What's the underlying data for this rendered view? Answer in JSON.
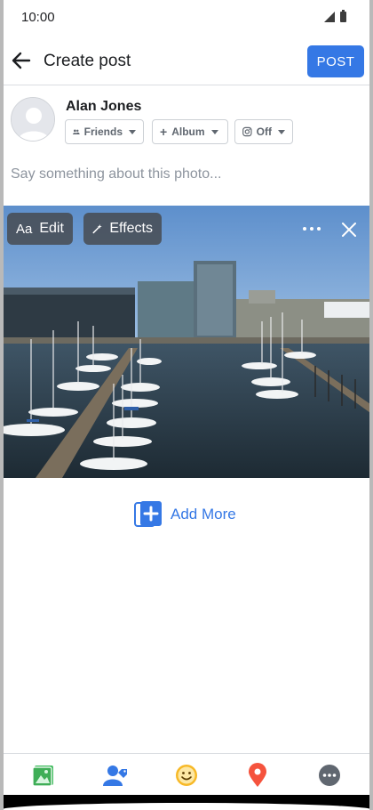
{
  "status_bar": {
    "time": "10:00"
  },
  "app_bar": {
    "title": "Create post",
    "post_label": "POST"
  },
  "author": {
    "name": "Alan Jones",
    "audience_label": "Friends",
    "album_label": "Album",
    "instagram_label": "Off"
  },
  "composer": {
    "placeholder": "Say something about this photo..."
  },
  "photo": {
    "edit_label": "Edit",
    "edit_icon_text": "Aa",
    "effects_label": "Effects"
  },
  "add_more": {
    "label": "Add More"
  },
  "bottom_toolbar": {
    "items": [
      "photo-video-icon",
      "tag-people-icon",
      "feeling-icon",
      "check-in-icon",
      "more-options-icon"
    ],
    "colors": {
      "photo": "#45bd62",
      "tag": "#3578e5",
      "feeling": "#f7b928",
      "checkin": "#f02849",
      "more": "#606770"
    }
  },
  "colors": {
    "accent": "#3578e5"
  }
}
